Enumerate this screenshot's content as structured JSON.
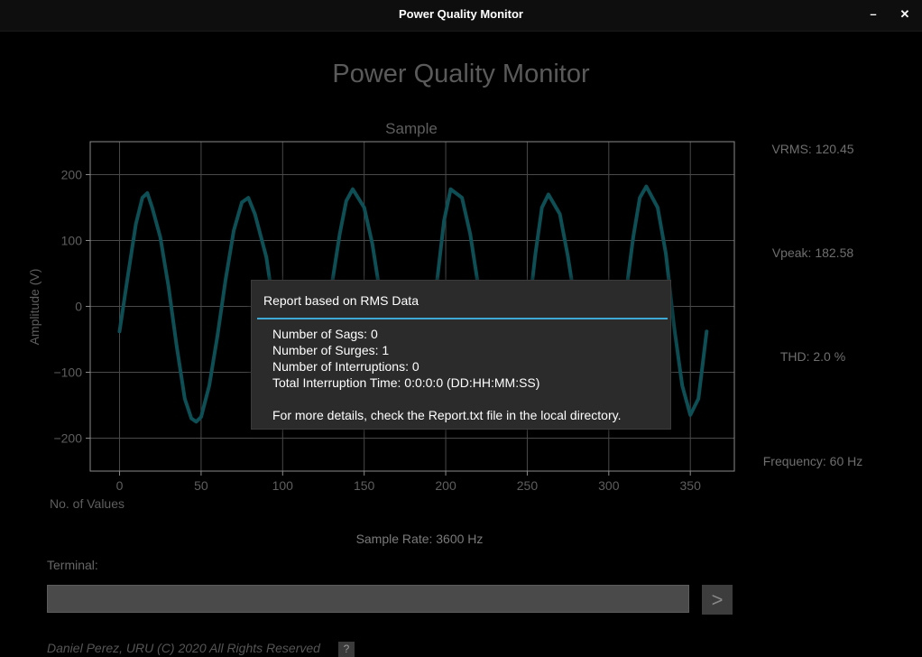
{
  "window": {
    "title": "Power Quality Monitor",
    "minimize_label": "–",
    "close_label": "✕"
  },
  "app_title": "Power Quality Monitor",
  "stats": {
    "vrms": "VRMS: 120.45",
    "vpeak": "Vpeak: 182.58",
    "thd": "THD: 2.0 %",
    "frequency": "Frequency: 60 Hz"
  },
  "sample_rate": "Sample Rate: 3600 Hz",
  "terminal": {
    "label": "Terminal:",
    "value": "",
    "send_label": ">"
  },
  "footer": {
    "text": "Daniel Perez, URU (C) 2020 All Rights Reserved",
    "help_label": "?"
  },
  "dialog": {
    "title": "Report based on RMS Data",
    "lines": [
      "Number of Sags: 0",
      "Number of Surges: 1",
      "Number of Interruptions: 0",
      "Total Interruption Time: 0:0:0:0 (DD:HH:MM:SS)",
      "",
      "For more details, check the Report.txt file in the local directory."
    ]
  },
  "colors": {
    "trace": "#0d4f55",
    "grid": "#4a4a4a",
    "axis_text": "#5e5e5e",
    "dialog_accent": "#3fa9d6"
  },
  "chart_data": {
    "type": "line",
    "title": "Sample",
    "xlabel": "No. of Values",
    "ylabel": "Amplitude (V)",
    "xlim": [
      -18,
      377
    ],
    "ylim": [
      -250,
      250
    ],
    "xticks": [
      0,
      50,
      100,
      150,
      200,
      250,
      300,
      350
    ],
    "yticks": [
      -200,
      -100,
      0,
      100,
      200
    ],
    "grid": true,
    "series": [
      {
        "x": [
          0,
          5,
          10,
          14,
          17,
          20,
          25,
          30,
          35,
          40,
          44,
          47,
          50,
          55,
          60,
          65,
          70,
          75,
          79,
          83,
          90,
          95,
          100,
          105,
          110,
          115,
          120,
          125,
          130,
          135,
          139,
          143,
          150,
          155,
          160,
          165,
          170,
          175,
          180,
          185,
          190,
          195,
          199,
          203,
          210,
          215,
          220,
          225,
          230,
          235,
          240,
          245,
          250,
          255,
          259,
          263,
          270,
          275,
          280,
          285,
          290,
          295,
          300,
          305,
          310,
          315,
          319,
          323,
          330,
          335,
          340,
          345,
          350,
          355,
          360
        ],
        "y": [
          -38,
          45,
          125,
          165,
          172,
          150,
          105,
          30,
          -60,
          -140,
          -170,
          -175,
          -168,
          -120,
          -45,
          40,
          115,
          158,
          165,
          140,
          75,
          -10,
          -90,
          -155,
          -175,
          -170,
          -130,
          -55,
          30,
          110,
          160,
          178,
          150,
          95,
          15,
          -70,
          -145,
          -172,
          -168,
          -125,
          -50,
          45,
          130,
          178,
          165,
          110,
          30,
          -60,
          -140,
          -170,
          -160,
          -110,
          -30,
          80,
          150,
          170,
          140,
          75,
          -5,
          -90,
          -150,
          -168,
          -150,
          -80,
          10,
          105,
          165,
          182,
          150,
          80,
          -30,
          -120,
          -165,
          -140,
          -38
        ]
      }
    ]
  }
}
